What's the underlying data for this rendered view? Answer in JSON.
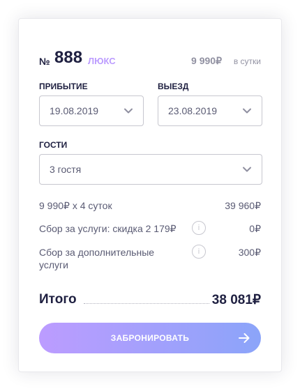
{
  "room": {
    "number_sign": "№",
    "number": "888",
    "type": "люкс",
    "price": "9 990₽",
    "price_unit": "в сутки"
  },
  "arrival": {
    "label": "прибытие",
    "value": "19.08.2019"
  },
  "departure": {
    "label": "выезд",
    "value": "23.08.2019"
  },
  "guests": {
    "label": "гости",
    "value": "3 гостя"
  },
  "calculation": [
    {
      "text": "9 990₽ х 4 суток",
      "amount": "39 960₽",
      "info": false
    },
    {
      "text": "Сбор за услуги: скидка 2 179₽",
      "amount": "0₽",
      "info": true
    },
    {
      "text": "Сбор за дополнительные услуги",
      "amount": "300₽",
      "info": true
    }
  ],
  "info_glyph": "i",
  "total": {
    "label": "Итого",
    "value": "38 081₽"
  },
  "book_button": {
    "label": "забронировать"
  },
  "icons": {
    "dropdown": "chevron-down-icon",
    "info": "info-icon",
    "submit": "arrow-right-icon"
  },
  "colors": {
    "accent": "#bc9cff",
    "accent_end": "#8ba4f9",
    "text": "#1f2041"
  }
}
